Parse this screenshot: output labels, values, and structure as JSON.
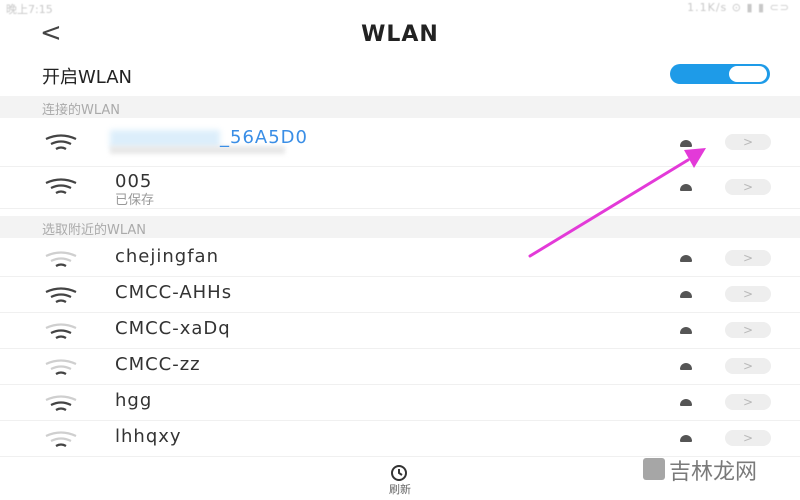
{
  "status_bar": {
    "time": "晚上7:15",
    "right": "1.1K/s ⊙ ▮ ▮ ⊂⊃"
  },
  "header": {
    "back_glyph": "<",
    "title": "WLAN"
  },
  "toggle": {
    "label": "开启WLAN",
    "on": true
  },
  "sections": {
    "connected": "连接的WLAN",
    "nearby": "选取附近的WLAN"
  },
  "connected_networks": [
    {
      "name": "_56A5D0",
      "subtitle": ""
    },
    {
      "name": "005",
      "subtitle": "已保存"
    }
  ],
  "nearby_networks": [
    {
      "name": "chejingfan"
    },
    {
      "name": "CMCC-AHHs"
    },
    {
      "name": "CMCC-xaDq"
    },
    {
      "name": "CMCC-zz"
    },
    {
      "name": "hgg"
    },
    {
      "name": "lhhqxy"
    }
  ],
  "chevron_glyph": ">",
  "refresh": {
    "label": "刷新"
  },
  "watermark": {
    "text": "吉林龙网"
  },
  "colors": {
    "accent": "#1e9be8",
    "arrow": "#e33ad8",
    "connected_text": "#3a8ee6"
  }
}
